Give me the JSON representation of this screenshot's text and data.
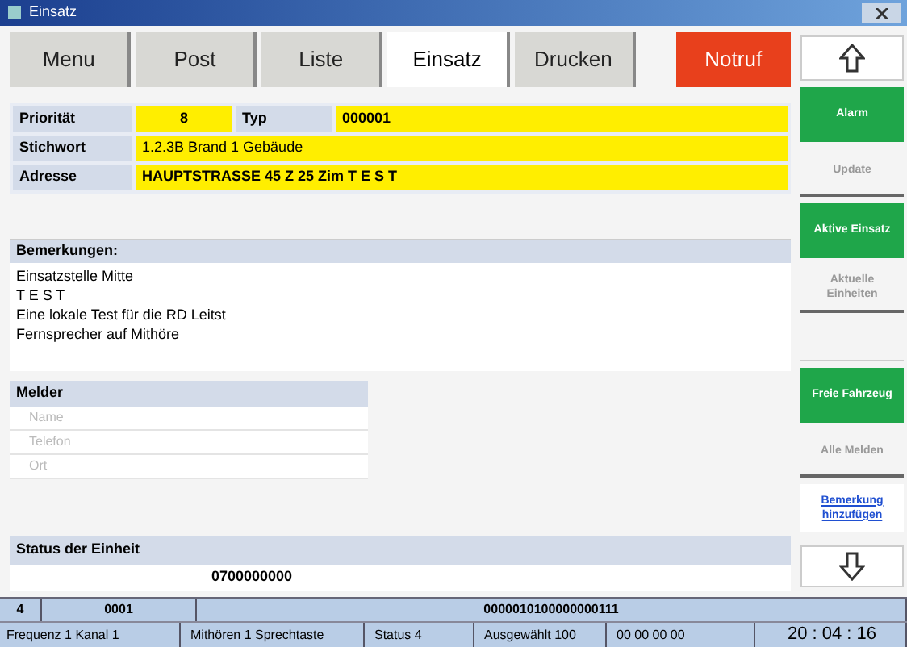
{
  "window": {
    "title": "Einsatz"
  },
  "tabs": [
    {
      "label": "Menu",
      "selected": false,
      "kind": "tab"
    },
    {
      "label": "Post",
      "selected": false,
      "kind": "tab"
    },
    {
      "label": "Liste",
      "selected": false,
      "kind": "tab"
    },
    {
      "label": "Einsatz",
      "selected": true,
      "kind": "tab"
    },
    {
      "label": "Drucken",
      "selected": false,
      "kind": "tab"
    },
    {
      "label": "Notruf",
      "selected": false,
      "kind": "alarm"
    }
  ],
  "incident": {
    "priority_label": "Priorität",
    "priority": "8",
    "type_label": "Typ",
    "type": "000001",
    "keyword_label": "Stichwort",
    "keyword": "1.2.3B Brand 1 Gebäude",
    "address_label": "Adresse",
    "address": "HAUPTSTRASSE 45 Z 25 Zim T E S T"
  },
  "remarks": {
    "title": "Bemerkungen:",
    "lines": [
      "Einsatzstelle Mitte",
      "T E S T",
      "Eine lokale Test für die RD Leitst",
      "Fernsprecher auf Mithöre"
    ]
  },
  "reporter": {
    "title": "Melder",
    "rows": [
      "Name",
      "Telefon",
      "Ort"
    ]
  },
  "unit_status": {
    "title": "Status der Einheit",
    "value": "0700000000"
  },
  "side_buttons": [
    {
      "label": "Alarm",
      "kind": "green"
    },
    {
      "label": "Update",
      "kind": "plain"
    },
    {
      "label": "Aktive Einsatz",
      "kind": "green"
    },
    {
      "label": "Aktuelle Einheiten",
      "kind": "plain"
    },
    {
      "kind": "blank"
    },
    {
      "label": "Freie Fahrzeug",
      "kind": "green"
    },
    {
      "label": "Alle Melden",
      "kind": "plain"
    },
    {
      "label": "Bemerkung hinzufügen",
      "kind": "link"
    }
  ],
  "bottom_bar": [
    "4",
    "0001",
    "0000010100000000111"
  ],
  "status_bar": [
    "Frequenz 1 Kanal 1",
    "Mithören 1 Sprechtaste",
    "Status 4",
    "Ausgewählt 100",
    "00 00 00 00",
    "20 : 04 : 16"
  ]
}
